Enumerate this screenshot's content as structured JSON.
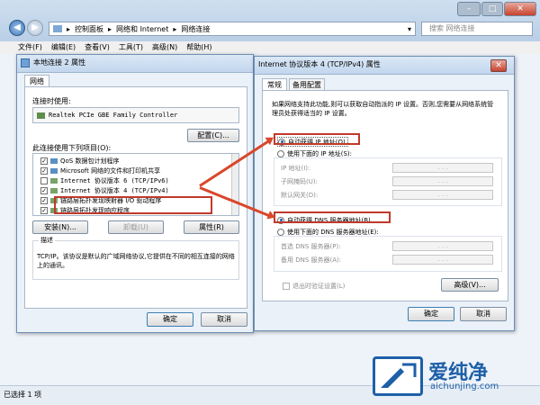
{
  "explorer": {
    "breadcrumb": [
      "控制面板",
      "网络和 Internet",
      "网络连接"
    ],
    "search_placeholder": "搜索 网络连接",
    "menu": [
      "文件(F)",
      "编辑(E)",
      "查看(V)",
      "工具(T)",
      "高级(N)",
      "帮助(H)"
    ],
    "status": "已选择 1 项"
  },
  "props": {
    "title": "本地连接 2 属性",
    "tab": "网络",
    "connect_using_label": "连接时使用:",
    "adapter": "Realtek PCIe GBE Family Controller",
    "configure_button": "配置(C)...",
    "items_label": "此连接使用下列项目(O):",
    "items": [
      {
        "checked": true,
        "label": "QoS 数据包计划程序"
      },
      {
        "checked": true,
        "label": "Microsoft 网络的文件和打印机共享"
      },
      {
        "checked": false,
        "label": "Internet 协议版本 6 (TCP/IPv6)"
      },
      {
        "checked": true,
        "label": "Internet 协议版本 4 (TCP/IPv4)"
      },
      {
        "checked": true,
        "label": "链路层拓扑发现映射器 I/O 驱动程序"
      },
      {
        "checked": true,
        "label": "链路层拓扑发现响应程序"
      }
    ],
    "install_button": "安装(N)...",
    "uninstall_button": "卸载(U)",
    "properties_button": "属性(R)",
    "description_title": "描述",
    "description": "TCP/IP。该协议是默认的广域网络协议,它提供在不同的相互连接的网络上的通讯。",
    "ok_button": "确定",
    "cancel_button": "取消"
  },
  "ipv4": {
    "title": "Internet 协议版本 4 (TCP/IPv4) 属性",
    "tabs": [
      "常规",
      "备用配置"
    ],
    "intro": "如果网络支持此功能,则可以获取自动指派的 IP 设置。否则,您需要从网络系统管理员处获得适当的 IP 设置。",
    "auto_ip": "自动获得 IP 地址(O)",
    "manual_ip": "使用下面的 IP 地址(S):",
    "ip_address": "IP 地址(I):",
    "subnet_mask": "子网掩码(U):",
    "gateway": "默认网关(D):",
    "auto_dns": "自动获得 DNS 服务器地址(B)",
    "manual_dns": "使用下面的 DNS 服务器地址(E):",
    "preferred_dns": "首选 DNS 服务器(P):",
    "alternate_dns": "备用 DNS 服务器(A):",
    "validate_on_exit": "退出时验证设置(L)",
    "advanced_button": "高级(V)...",
    "ok_button": "确定",
    "cancel_button": "取消",
    "ip_dots": ". . ."
  },
  "watermark": {
    "brand": "爱纯净",
    "url": "aichunjing.com"
  },
  "colors": {
    "highlight": "#d9472a",
    "logo": "#1d5fa8"
  }
}
